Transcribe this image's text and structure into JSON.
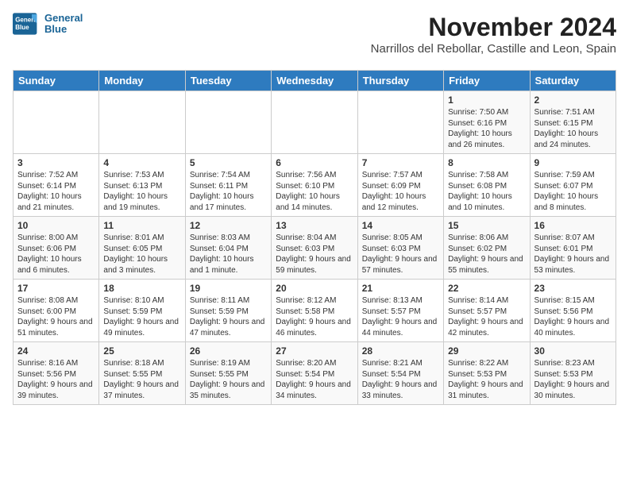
{
  "logo": {
    "line1": "General",
    "line2": "Blue"
  },
  "title": "November 2024",
  "subtitle": "Narrillos del Rebollar, Castille and Leon, Spain",
  "days_of_week": [
    "Sunday",
    "Monday",
    "Tuesday",
    "Wednesday",
    "Thursday",
    "Friday",
    "Saturday"
  ],
  "weeks": [
    [
      {
        "day": "",
        "content": ""
      },
      {
        "day": "",
        "content": ""
      },
      {
        "day": "",
        "content": ""
      },
      {
        "day": "",
        "content": ""
      },
      {
        "day": "",
        "content": ""
      },
      {
        "day": "1",
        "content": "Sunrise: 7:50 AM\nSunset: 6:16 PM\nDaylight: 10 hours and 26 minutes."
      },
      {
        "day": "2",
        "content": "Sunrise: 7:51 AM\nSunset: 6:15 PM\nDaylight: 10 hours and 24 minutes."
      }
    ],
    [
      {
        "day": "3",
        "content": "Sunrise: 7:52 AM\nSunset: 6:14 PM\nDaylight: 10 hours and 21 minutes."
      },
      {
        "day": "4",
        "content": "Sunrise: 7:53 AM\nSunset: 6:13 PM\nDaylight: 10 hours and 19 minutes."
      },
      {
        "day": "5",
        "content": "Sunrise: 7:54 AM\nSunset: 6:11 PM\nDaylight: 10 hours and 17 minutes."
      },
      {
        "day": "6",
        "content": "Sunrise: 7:56 AM\nSunset: 6:10 PM\nDaylight: 10 hours and 14 minutes."
      },
      {
        "day": "7",
        "content": "Sunrise: 7:57 AM\nSunset: 6:09 PM\nDaylight: 10 hours and 12 minutes."
      },
      {
        "day": "8",
        "content": "Sunrise: 7:58 AM\nSunset: 6:08 PM\nDaylight: 10 hours and 10 minutes."
      },
      {
        "day": "9",
        "content": "Sunrise: 7:59 AM\nSunset: 6:07 PM\nDaylight: 10 hours and 8 minutes."
      }
    ],
    [
      {
        "day": "10",
        "content": "Sunrise: 8:00 AM\nSunset: 6:06 PM\nDaylight: 10 hours and 6 minutes."
      },
      {
        "day": "11",
        "content": "Sunrise: 8:01 AM\nSunset: 6:05 PM\nDaylight: 10 hours and 3 minutes."
      },
      {
        "day": "12",
        "content": "Sunrise: 8:03 AM\nSunset: 6:04 PM\nDaylight: 10 hours and 1 minute."
      },
      {
        "day": "13",
        "content": "Sunrise: 8:04 AM\nSunset: 6:03 PM\nDaylight: 9 hours and 59 minutes."
      },
      {
        "day": "14",
        "content": "Sunrise: 8:05 AM\nSunset: 6:03 PM\nDaylight: 9 hours and 57 minutes."
      },
      {
        "day": "15",
        "content": "Sunrise: 8:06 AM\nSunset: 6:02 PM\nDaylight: 9 hours and 55 minutes."
      },
      {
        "day": "16",
        "content": "Sunrise: 8:07 AM\nSunset: 6:01 PM\nDaylight: 9 hours and 53 minutes."
      }
    ],
    [
      {
        "day": "17",
        "content": "Sunrise: 8:08 AM\nSunset: 6:00 PM\nDaylight: 9 hours and 51 minutes."
      },
      {
        "day": "18",
        "content": "Sunrise: 8:10 AM\nSunset: 5:59 PM\nDaylight: 9 hours and 49 minutes."
      },
      {
        "day": "19",
        "content": "Sunrise: 8:11 AM\nSunset: 5:59 PM\nDaylight: 9 hours and 47 minutes."
      },
      {
        "day": "20",
        "content": "Sunrise: 8:12 AM\nSunset: 5:58 PM\nDaylight: 9 hours and 46 minutes."
      },
      {
        "day": "21",
        "content": "Sunrise: 8:13 AM\nSunset: 5:57 PM\nDaylight: 9 hours and 44 minutes."
      },
      {
        "day": "22",
        "content": "Sunrise: 8:14 AM\nSunset: 5:57 PM\nDaylight: 9 hours and 42 minutes."
      },
      {
        "day": "23",
        "content": "Sunrise: 8:15 AM\nSunset: 5:56 PM\nDaylight: 9 hours and 40 minutes."
      }
    ],
    [
      {
        "day": "24",
        "content": "Sunrise: 8:16 AM\nSunset: 5:56 PM\nDaylight: 9 hours and 39 minutes."
      },
      {
        "day": "25",
        "content": "Sunrise: 8:18 AM\nSunset: 5:55 PM\nDaylight: 9 hours and 37 minutes."
      },
      {
        "day": "26",
        "content": "Sunrise: 8:19 AM\nSunset: 5:55 PM\nDaylight: 9 hours and 35 minutes."
      },
      {
        "day": "27",
        "content": "Sunrise: 8:20 AM\nSunset: 5:54 PM\nDaylight: 9 hours and 34 minutes."
      },
      {
        "day": "28",
        "content": "Sunrise: 8:21 AM\nSunset: 5:54 PM\nDaylight: 9 hours and 33 minutes."
      },
      {
        "day": "29",
        "content": "Sunrise: 8:22 AM\nSunset: 5:53 PM\nDaylight: 9 hours and 31 minutes."
      },
      {
        "day": "30",
        "content": "Sunrise: 8:23 AM\nSunset: 5:53 PM\nDaylight: 9 hours and 30 minutes."
      }
    ]
  ]
}
